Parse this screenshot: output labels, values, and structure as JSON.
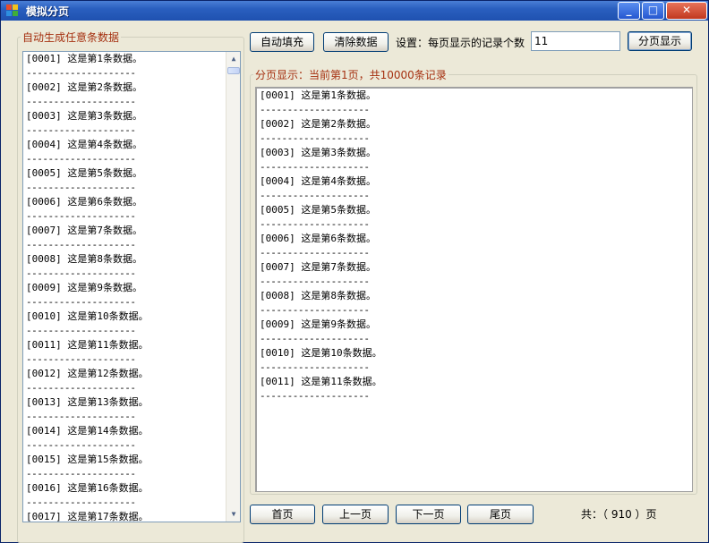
{
  "window": {
    "title": "模拟分页",
    "controls": {
      "minimize": "_",
      "maximize": "□",
      "close": "✕"
    }
  },
  "left_group": {
    "label": "自动生成任意条数据",
    "records": [
      "[0001] 这是第1条数据。",
      "[0002] 这是第2条数据。",
      "[0003] 这是第3条数据。",
      "[0004] 这是第4条数据。",
      "[0005] 这是第5条数据。",
      "[0006] 这是第6条数据。",
      "[0007] 这是第7条数据。",
      "[0008] 这是第8条数据。",
      "[0009] 这是第9条数据。",
      "[0010] 这是第10条数据。",
      "[0011] 这是第11条数据。",
      "[0012] 这是第12条数据。",
      "[0013] 这是第13条数据。",
      "[0014] 这是第14条数据。",
      "[0015] 这是第15条数据。",
      "[0016] 这是第16条数据。",
      "[0017] 这是第17条数据。"
    ],
    "separator": "--------------------"
  },
  "toolbar": {
    "autofill_label": "自动填充",
    "clear_label": "清除数据",
    "setting_label": "设置：每页显示的记录个数",
    "page_size_value": "11",
    "paginate_label": "分页显示"
  },
  "right_group": {
    "label": "分页显示：当前第1页，共10000条记录",
    "records": [
      "[0001] 这是第1条数据。",
      "[0002] 这是第2条数据。",
      "[0003] 这是第3条数据。",
      "[0004] 这是第4条数据。",
      "[0005] 这是第5条数据。",
      "[0006] 这是第6条数据。",
      "[0007] 这是第7条数据。",
      "[0008] 这是第8条数据。",
      "[0009] 这是第9条数据。",
      "[0010] 这是第10条数据。",
      "[0011] 这是第11条数据。"
    ],
    "separator": "--------------------"
  },
  "pager": {
    "first_label": "首页",
    "prev_label": "上一页",
    "next_label": "下一页",
    "last_label": "尾页",
    "total_pages_label": "共：（ 910 ）页"
  }
}
